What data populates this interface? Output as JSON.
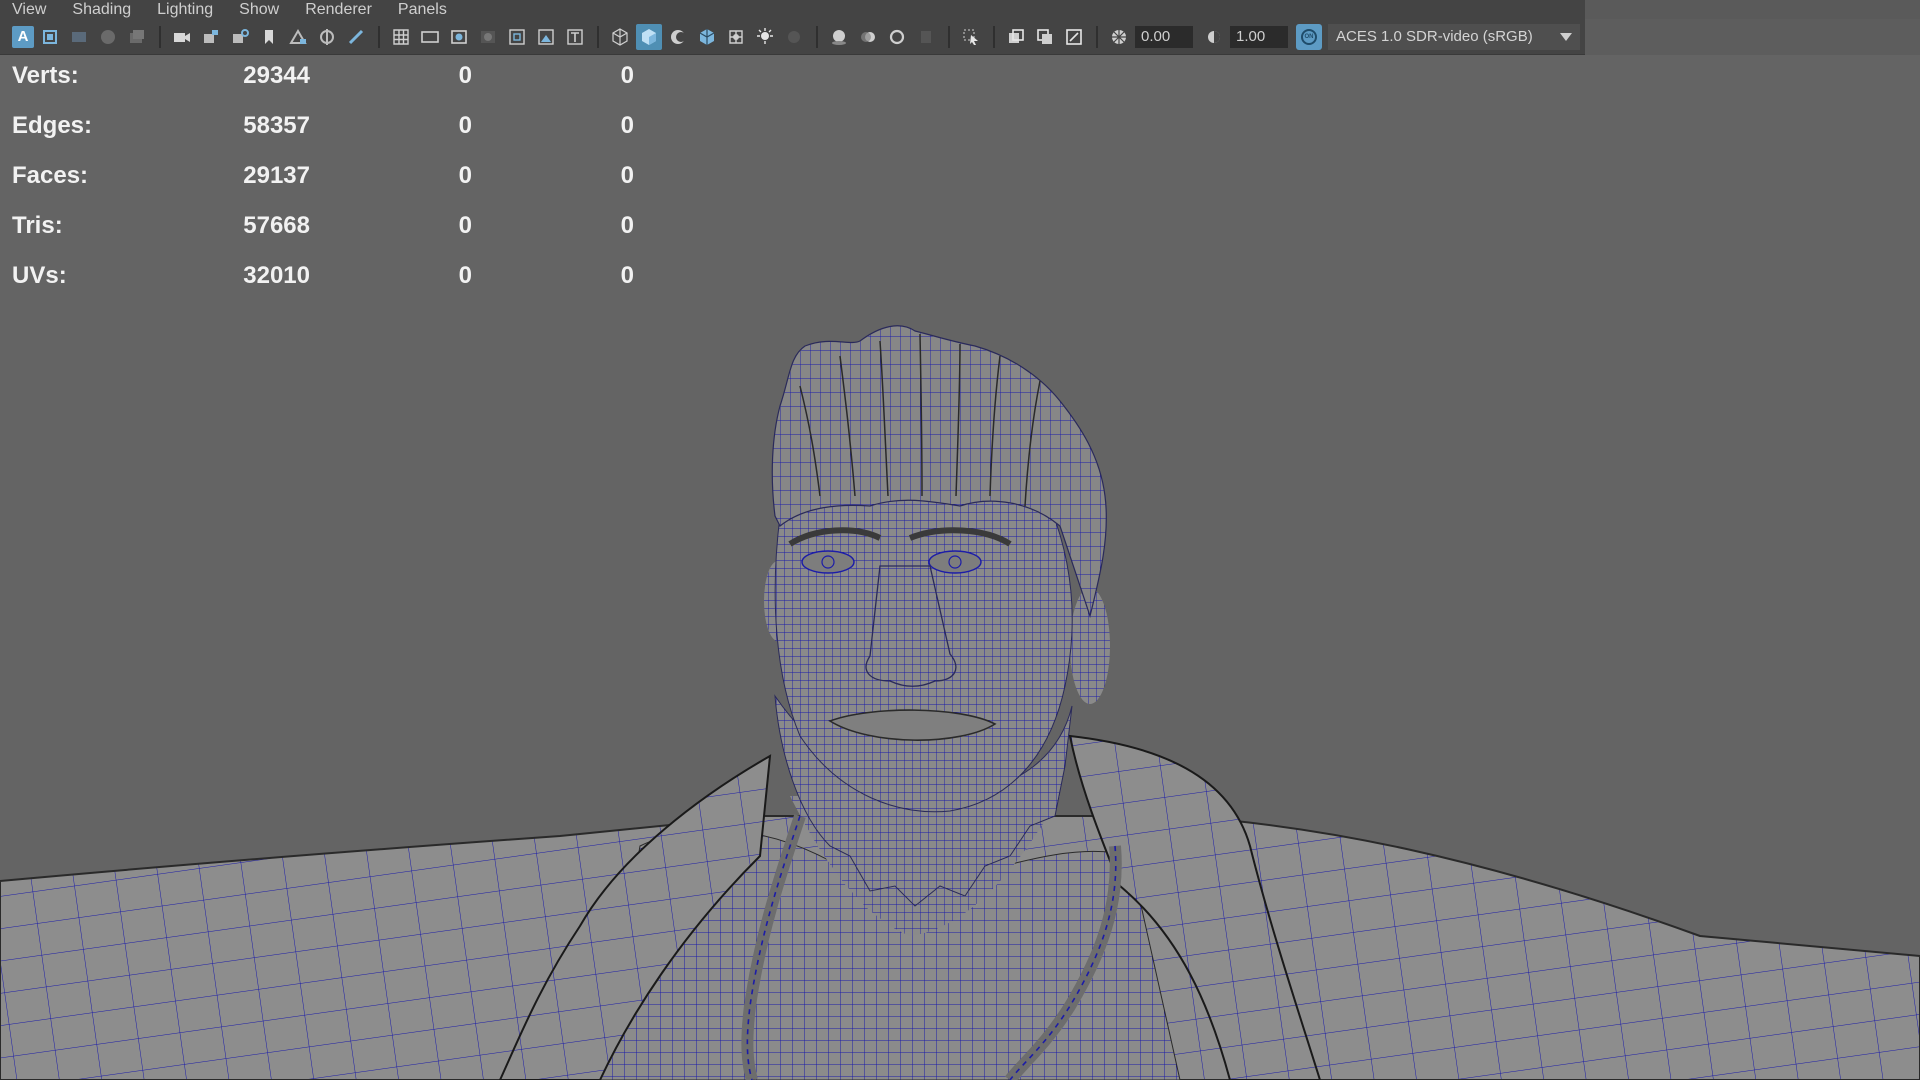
{
  "menu": [
    "View",
    "Shading",
    "Lighting",
    "Show",
    "Renderer",
    "Panels"
  ],
  "toolbar": {
    "exposure_value": "0.00",
    "gamma_value": "1.00",
    "color_management_badge": "ON",
    "color_space": "ACES 1.0 SDR-video (sRGB)",
    "icons": [
      "select-camera-icon",
      "camera-attributes-icon",
      "bookmark-icon",
      "image-plane-icon",
      "grid-icon",
      "film-gate-icon",
      "resolution-gate-icon",
      "gate-mask-icon",
      "field-chart-icon",
      "safe-action-icon",
      "safe-title-icon",
      "wireframe-icon",
      "smooth-shade-icon",
      "default-material-icon",
      "wireframe-on-shaded-icon",
      "xray-icon",
      "use-all-lights-icon",
      "shadows-icon",
      "ambient-occlusion-icon",
      "motion-blur-icon",
      "anti-aliasing-icon",
      "isolate-select-icon",
      "xray-joints-icon",
      "xray-active-icon",
      "backface-icon",
      "exposure-icon",
      "gamma-icon"
    ]
  },
  "hud": {
    "rows": [
      {
        "label": "Verts:",
        "total": "29344",
        "selected": "0",
        "third": "0"
      },
      {
        "label": "Edges:",
        "total": "58357",
        "selected": "0",
        "third": "0"
      },
      {
        "label": "Faces:",
        "total": "29137",
        "selected": "0",
        "third": "0"
      },
      {
        "label": "Tris:",
        "total": "57668",
        "selected": "0",
        "third": "0"
      },
      {
        "label": "UVs:",
        "total": "32010",
        "selected": "0",
        "third": "0"
      }
    ]
  },
  "viewport": {
    "background": "#646464",
    "mesh_fill": "#8a8a8a",
    "wire_color": "#1c1ca8",
    "subject": "character-wireframe-mesh"
  }
}
